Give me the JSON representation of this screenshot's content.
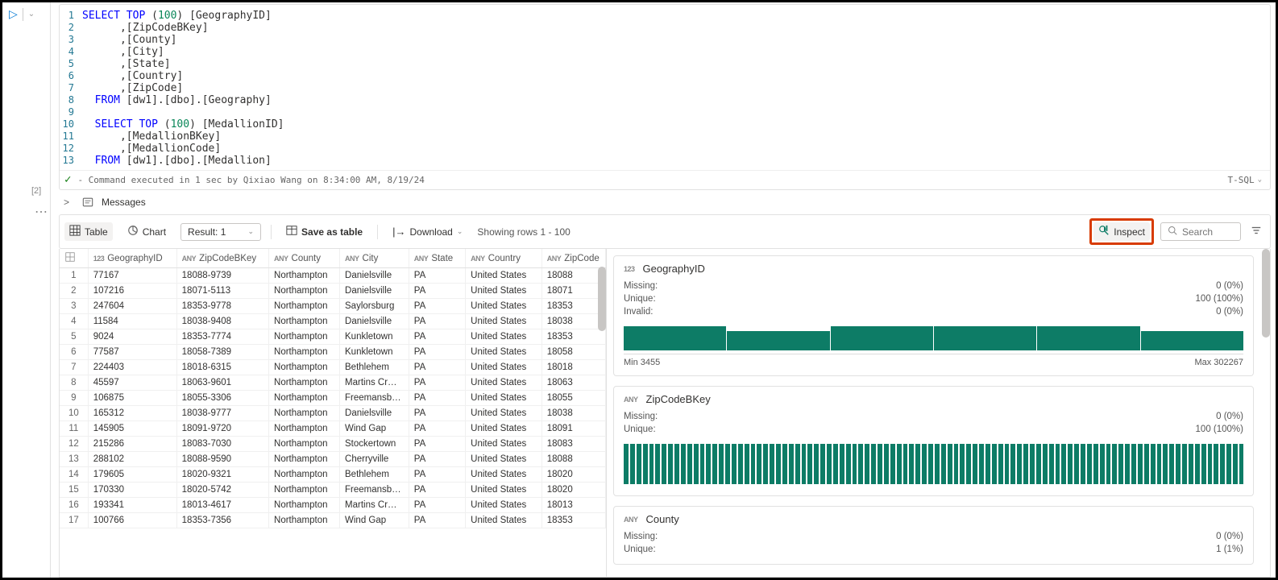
{
  "editor": {
    "lines": [
      {
        "n": "1",
        "html": "<span class='kw'>SELECT</span> <span class='kw'>TOP</span> (<span class='num'>100</span>) [GeographyID]"
      },
      {
        "n": "2",
        "html": "      ,[ZipCodeBKey]"
      },
      {
        "n": "3",
        "html": "      ,[County]"
      },
      {
        "n": "4",
        "html": "      ,[City]"
      },
      {
        "n": "5",
        "html": "      ,[State]"
      },
      {
        "n": "6",
        "html": "      ,[Country]"
      },
      {
        "n": "7",
        "html": "      ,[ZipCode]"
      },
      {
        "n": "8",
        "html": "  <span class='kw'>FROM</span> [dw1].[dbo].[Geography]"
      },
      {
        "n": "9",
        "html": ""
      },
      {
        "n": "10",
        "html": "  <span class='kw'>SELECT</span> <span class='kw'>TOP</span> (<span class='num'>100</span>) [MedallionID]"
      },
      {
        "n": "11",
        "html": "      ,[MedallionBKey]"
      },
      {
        "n": "12",
        "html": "      ,[MedallionCode]"
      },
      {
        "n": "13",
        "html": "  <span class='kw'>FROM</span> [dw1].[dbo].[Medallion]"
      }
    ],
    "status": "- Command executed in 1 sec by Qixiao Wang on 8:34:00 AM, 8/19/24",
    "cell_index": "[2]",
    "language": "T-SQL"
  },
  "results_header": {
    "messages_label": "Messages"
  },
  "toolbar": {
    "table_label": "Table",
    "chart_label": "Chart",
    "result_label": "Result: 1",
    "save_label": "Save as table",
    "download_label": "Download",
    "rows_label": "Showing rows 1 - 100",
    "inspect_label": "Inspect",
    "search_placeholder": "Search"
  },
  "grid": {
    "columns": [
      {
        "type": "icon",
        "label": ""
      },
      {
        "type": "123",
        "label": "GeographyID"
      },
      {
        "type": "ANY",
        "label": "ZipCodeBKey"
      },
      {
        "type": "ANY",
        "label": "County"
      },
      {
        "type": "ANY",
        "label": "City"
      },
      {
        "type": "ANY",
        "label": "State"
      },
      {
        "type": "ANY",
        "label": "Country"
      },
      {
        "type": "ANY",
        "label": "ZipCode"
      }
    ],
    "rows": [
      [
        "1",
        "77167",
        "18088-9739",
        "Northampton",
        "Danielsville",
        "PA",
        "United States",
        "18088"
      ],
      [
        "2",
        "107216",
        "18071-5113",
        "Northampton",
        "Danielsville",
        "PA",
        "United States",
        "18071"
      ],
      [
        "3",
        "247604",
        "18353-9778",
        "Northampton",
        "Saylorsburg",
        "PA",
        "United States",
        "18353"
      ],
      [
        "4",
        "11584",
        "18038-9408",
        "Northampton",
        "Danielsville",
        "PA",
        "United States",
        "18038"
      ],
      [
        "5",
        "9024",
        "18353-7774",
        "Northampton",
        "Kunkletown",
        "PA",
        "United States",
        "18353"
      ],
      [
        "6",
        "77587",
        "18058-7389",
        "Northampton",
        "Kunkletown",
        "PA",
        "United States",
        "18058"
      ],
      [
        "7",
        "224403",
        "18018-6315",
        "Northampton",
        "Bethlehem",
        "PA",
        "United States",
        "18018"
      ],
      [
        "8",
        "45597",
        "18063-9601",
        "Northampton",
        "Martins Cr…",
        "PA",
        "United States",
        "18063"
      ],
      [
        "9",
        "106875",
        "18055-3306",
        "Northampton",
        "Freemansb…",
        "PA",
        "United States",
        "18055"
      ],
      [
        "10",
        "165312",
        "18038-9777",
        "Northampton",
        "Danielsville",
        "PA",
        "United States",
        "18038"
      ],
      [
        "11",
        "145905",
        "18091-9720",
        "Northampton",
        "Wind Gap",
        "PA",
        "United States",
        "18091"
      ],
      [
        "12",
        "215286",
        "18083-7030",
        "Northampton",
        "Stockertown",
        "PA",
        "United States",
        "18083"
      ],
      [
        "13",
        "288102",
        "18088-9590",
        "Northampton",
        "Cherryville",
        "PA",
        "United States",
        "18088"
      ],
      [
        "14",
        "179605",
        "18020-9321",
        "Northampton",
        "Bethlehem",
        "PA",
        "United States",
        "18020"
      ],
      [
        "15",
        "170330",
        "18020-5742",
        "Northampton",
        "Freemansb…",
        "PA",
        "United States",
        "18020"
      ],
      [
        "16",
        "193341",
        "18013-4617",
        "Northampton",
        "Martins Cr…",
        "PA",
        "United States",
        "18013"
      ],
      [
        "17",
        "100766",
        "18353-7356",
        "Northampton",
        "Wind Gap",
        "PA",
        "United States",
        "18353"
      ]
    ]
  },
  "inspect": {
    "cards": [
      {
        "type": "123",
        "title": "GeographyID",
        "stats": [
          [
            "Missing:",
            "0 (0%)"
          ],
          [
            "Unique:",
            "100 (100%)"
          ],
          [
            "Invalid:",
            "0 (0%)"
          ]
        ],
        "histo": "wide",
        "min": "Min 3455",
        "max": "Max 302267"
      },
      {
        "type": "ANY",
        "title": "ZipCodeBKey",
        "stats": [
          [
            "Missing:",
            "0 (0%)"
          ],
          [
            "Unique:",
            "100 (100%)"
          ]
        ],
        "histo": "dense"
      },
      {
        "type": "ANY",
        "title": "County",
        "stats": [
          [
            "Missing:",
            "0 (0%)"
          ],
          [
            "Unique:",
            "1 (1%)"
          ]
        ],
        "histo": "none"
      }
    ]
  },
  "chart_data": [
    {
      "type": "bar",
      "title": "GeographyID distribution",
      "xlabel": "",
      "ylabel": "",
      "xlim": [
        3455,
        302267
      ],
      "bins": 6,
      "values": [
        100,
        80,
        100,
        100,
        100,
        80
      ],
      "note": "approximate relative bar heights; Min 3455, Max 302267"
    },
    {
      "type": "bar",
      "title": "ZipCodeBKey distribution",
      "xlabel": "",
      "ylabel": "",
      "bins": 100,
      "values_uniform": 1,
      "note": "~100 equal-height bars (each unique value once)"
    }
  ]
}
